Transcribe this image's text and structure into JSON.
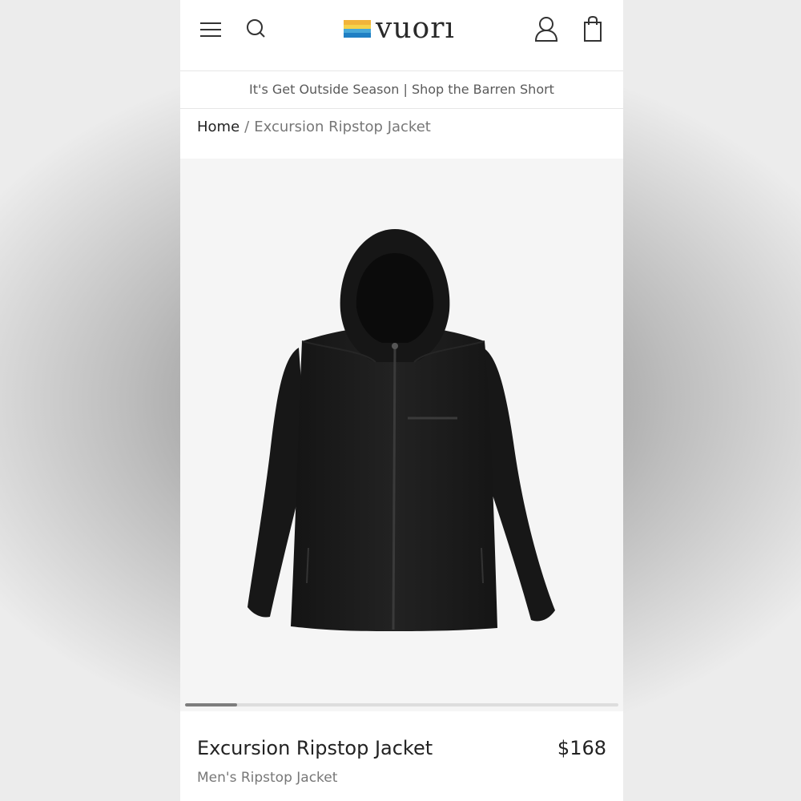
{
  "header": {
    "logo_text": "vuorı",
    "icons": {
      "menu": "hamburger-menu-icon",
      "search": "search-icon",
      "account": "user-account-icon",
      "cart": "shopping-bag-icon"
    },
    "logo_colors": [
      "#f2b43a",
      "#f6d24a",
      "#47a7d8",
      "#1f7fc4"
    ]
  },
  "promo": {
    "text": "It's Get Outside Season | Shop the Barren Short"
  },
  "breadcrumb": {
    "home": "Home",
    "separator": "/",
    "current": "Excursion Ripstop Jacket"
  },
  "gallery": {
    "image_alt": "black hooded ripstop jacket",
    "scroll_progress_percent": 12
  },
  "product": {
    "title": "Excursion Ripstop Jacket",
    "price": "$168",
    "subtitle": "Men's Ripstop Jacket",
    "color": "#1b1b1b"
  }
}
